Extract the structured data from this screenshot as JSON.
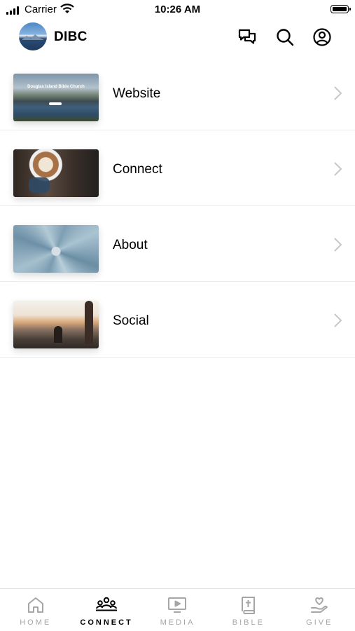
{
  "status_bar": {
    "carrier": "Carrier",
    "time": "10:26 AM"
  },
  "header": {
    "title": "DIBC"
  },
  "menu": [
    {
      "label": "Website",
      "thumb_text": "Douglas Island Bible Church"
    },
    {
      "label": "Connect"
    },
    {
      "label": "About"
    },
    {
      "label": "Social"
    }
  ],
  "tabs": [
    {
      "label": "HOME",
      "icon": "home-icon"
    },
    {
      "label": "CONNECT",
      "icon": "group-icon",
      "active": true
    },
    {
      "label": "MEDIA",
      "icon": "tv-play-icon"
    },
    {
      "label": "BIBLE",
      "icon": "bible-icon"
    },
    {
      "label": "GIVE",
      "icon": "heart-hand-icon"
    }
  ],
  "colors": {
    "active_tab": "#000000",
    "inactive_tab": "#a6a6a6",
    "divider": "#ececec",
    "chevron": "#c7c7cc"
  }
}
